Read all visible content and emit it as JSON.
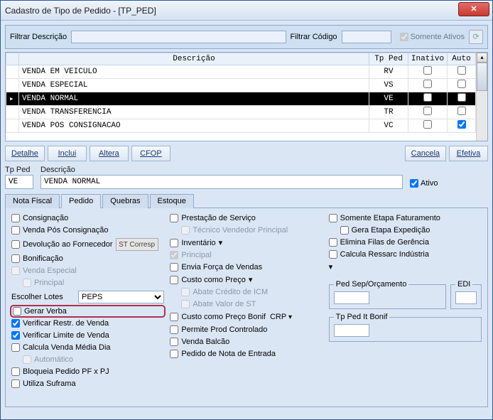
{
  "window": {
    "title": "Cadastro de Tipo de Pedido - [TP_PED]"
  },
  "filter": {
    "desc_label": "Filtrar Descrição",
    "desc_value": "",
    "cod_label": "Filtrar Código",
    "cod_value": "",
    "only_active_label": "Somente Ativos"
  },
  "grid": {
    "headers": {
      "desc": "Descrição",
      "tp": "Tp Ped",
      "inativo": "Inativo",
      "auto": "Auto"
    },
    "rows": [
      {
        "desc": "VENDA EM VEICULO",
        "tp": "RV",
        "inativo": false,
        "auto": false,
        "sel": false
      },
      {
        "desc": "VENDA ESPECIAL",
        "tp": "VS",
        "inativo": false,
        "auto": false,
        "sel": false
      },
      {
        "desc": "VENDA NORMAL",
        "tp": "VE",
        "inativo": false,
        "auto": false,
        "sel": true
      },
      {
        "desc": "VENDA TRANSFERENCIA",
        "tp": "TR",
        "inativo": false,
        "auto": false,
        "sel": false
      },
      {
        "desc": "VENDA POS CONSIGNACAO",
        "tp": "VC",
        "inativo": false,
        "auto": true,
        "sel": false
      }
    ]
  },
  "actions": {
    "detalhe": "Detalhe",
    "inclui": "Inclui",
    "altera": "Altera",
    "cfop": "CFOP",
    "cancela": "Cancela",
    "efetiva": "Efetiva"
  },
  "fields": {
    "tp_label": "Tp Ped",
    "tp_value": "VE",
    "desc_label": "Descrição",
    "desc_value": "VENDA NORMAL",
    "ativo_label": "Ativo"
  },
  "tabs": {
    "nf": "Nota Fiscal",
    "pedido": "Pedido",
    "quebras": "Quebras",
    "estoque": "Estoque"
  },
  "col1": {
    "consignacao": "Consignação",
    "pos_consig": "Venda Pós Consignação",
    "devolucao": "Devolução ao Fornecedor",
    "st_corresp": "ST Corresp",
    "bonificacao": "Bonificação",
    "venda_especial": "Venda Especial",
    "principal": "Principal",
    "escolher_lotes": "Escolher Lotes",
    "peps": "PEPS",
    "gerar_verba": "Gerar Verba",
    "verif_restr": "Verificar Restr. de Venda",
    "verif_limite": "Verificar Limite de Venda",
    "calc_media": "Calcula Venda Média Dia",
    "automatico": "Automático",
    "bloq_pf_pj": "Bloqueia Pedido PF x PJ",
    "suframa": "Utiliza Suframa"
  },
  "col2": {
    "prest_servico": "Prestação de Serviço",
    "tec_vendedor": "Técnico Vendedor Principal",
    "inventario": "Inventário",
    "principal": "Principal",
    "forca_vendas": "Envia Força de Vendas",
    "custo_preco": "Custo como Preço",
    "abate_icm": "Abate Crédito de ICM",
    "abate_st": "Abate Valor de ST",
    "custo_bonif": "Custo como Preço Bonif",
    "crp": "CRP",
    "prod_ctrl": "Permite Prod Controlado",
    "venda_balcao": "Venda Balcão",
    "nota_entrada": "Pedido de Nota de Entrada"
  },
  "col3": {
    "etapa_fat": "Somente Etapa Faturamento",
    "gera_exped": "Gera Etapa Expedição",
    "elim_filas": "Elimina Filas de Gerência",
    "calc_ressarc": "Calcula Ressarc Indústria",
    "ped_sep": "Ped Sep/Orçamento",
    "edi": "EDI",
    "tp_bonif": "Tp Ped It Bonif"
  }
}
